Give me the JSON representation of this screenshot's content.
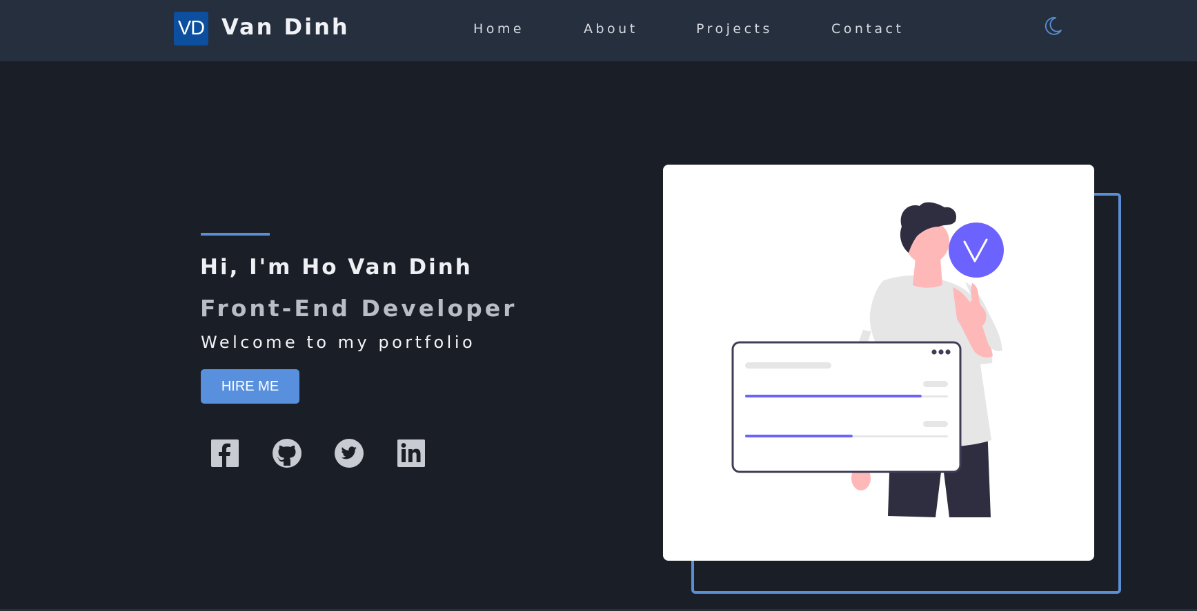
{
  "header": {
    "logo_initials": "VD",
    "logo_name": "Van Dinh",
    "nav": [
      {
        "label": "Home"
      },
      {
        "label": "About"
      },
      {
        "label": "Projects"
      },
      {
        "label": "Contact"
      }
    ],
    "theme_toggle_icon": "moon-icon"
  },
  "hero": {
    "greeting": "Hi, I'm Ho Van Dinh",
    "role": "Front-End Developer",
    "welcome": "Welcome to my portfolio",
    "cta_label": "HIRE ME",
    "socials": [
      {
        "icon": "facebook-icon"
      },
      {
        "icon": "github-icon"
      },
      {
        "icon": "twitter-icon"
      },
      {
        "icon": "linkedin-icon"
      }
    ]
  },
  "illustration": {
    "progress_bars": [
      0.87,
      0.53
    ]
  },
  "colors": {
    "background": "#1a1e27",
    "header": "#262f3e",
    "accent": "#5a8fd8",
    "logo_bg": "#0b4f9e",
    "illustration_purple": "#6c63ff"
  }
}
